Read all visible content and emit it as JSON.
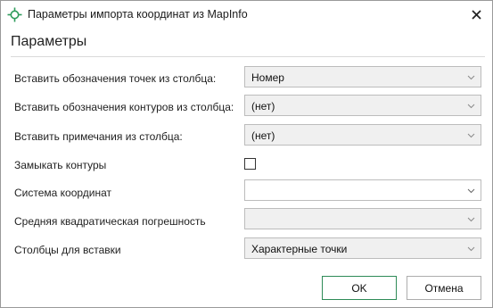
{
  "window": {
    "title": "Параметры импорта координат из MapInfo"
  },
  "section": {
    "header": "Параметры"
  },
  "rows": [
    {
      "label": "Вставить обозначения точек из столбца:",
      "value": "Номер"
    },
    {
      "label": "Вставить обозначения контуров из столбца:",
      "value": "(нет)"
    },
    {
      "label": "Вставить примечания из столбца:",
      "value": "(нет)"
    },
    {
      "label": "Замыкать контуры",
      "checked": false
    },
    {
      "label": "Система координат",
      "value": ""
    },
    {
      "label": "Средняя квадратическая погрешность",
      "value": ""
    },
    {
      "label": "Столбцы для вставки",
      "value": "Характерные точки"
    }
  ],
  "buttons": {
    "ok": "OK",
    "cancel": "Отмена"
  },
  "colors": {
    "ok_border": "#2e8b57",
    "app_icon": "#2e9b5b",
    "combo_disabled_bg": "#f0f0f0"
  },
  "icons": {
    "app": "target-crosshair-icon",
    "close": "close-icon",
    "dropdown": "chevron-down-icon"
  }
}
